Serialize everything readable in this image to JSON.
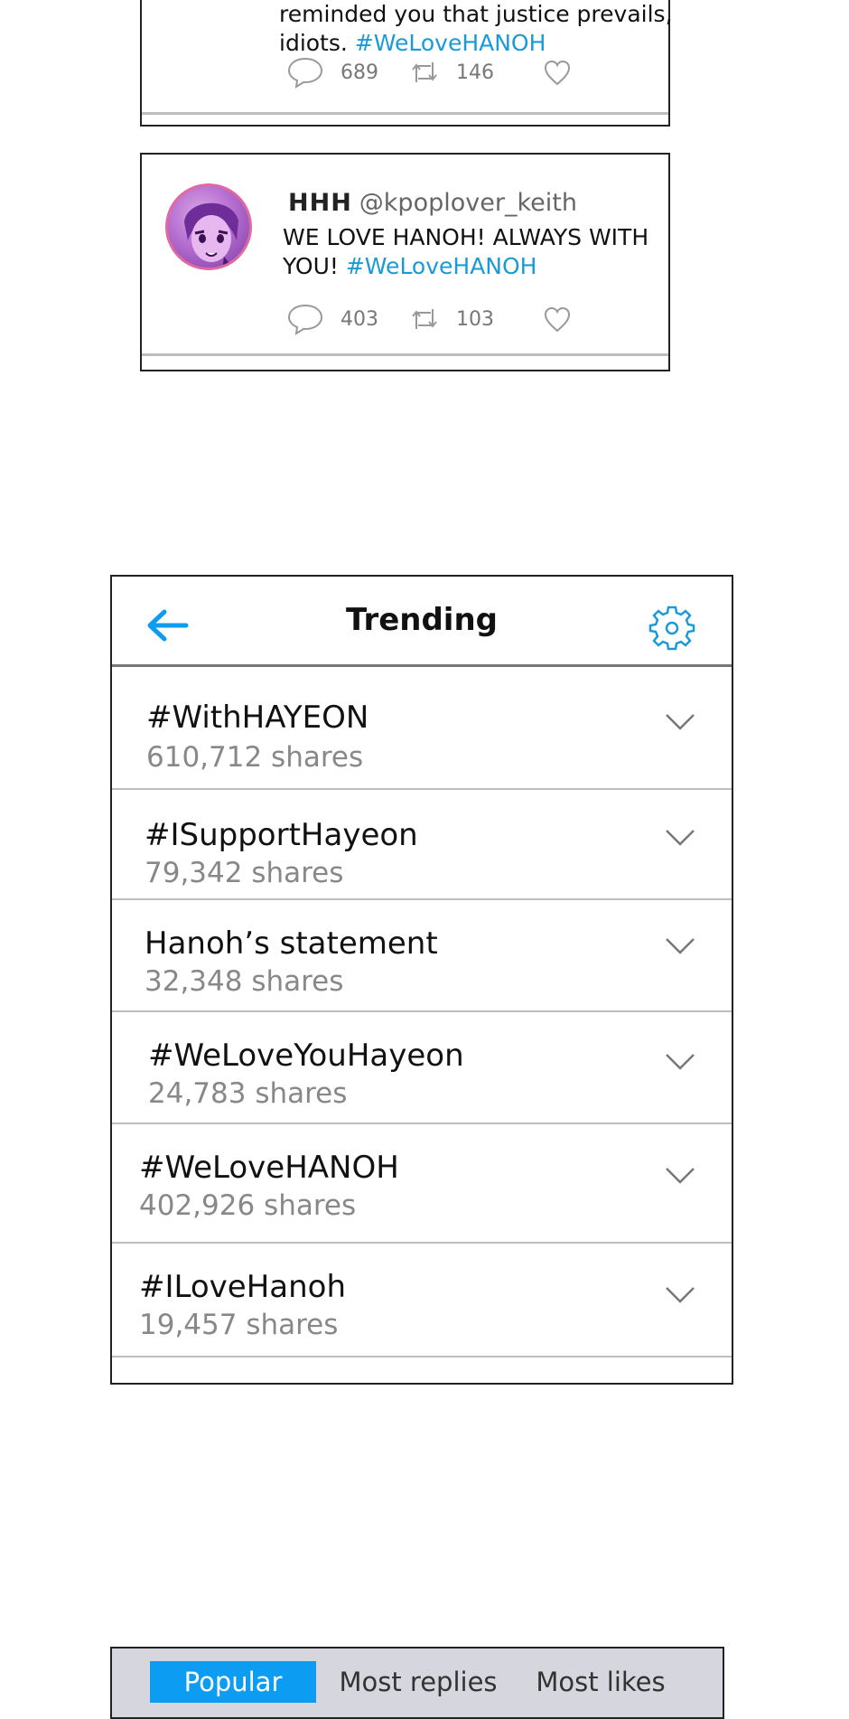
{
  "tweets": [
    {
      "text_line1": "reminded you that justice prevails,",
      "text_line2_prefix": "idiots. ",
      "hashtag": "#WeLoveHANOH",
      "replies": "689",
      "retweets": "146"
    },
    {
      "name": "HHH",
      "handle": "@kpoplover_keith",
      "text_line1": "WE LOVE HANOH! ALWAYS WITH",
      "text_line2_prefix": "YOU! ",
      "hashtag": "#WeLoveHANOH",
      "replies": "403",
      "retweets": "103"
    }
  ],
  "trending": {
    "title": "Trending",
    "items": [
      {
        "name": "#WithHAYEON",
        "shares": "610,712 shares"
      },
      {
        "name": "#ISupportHayeon",
        "shares": "79,342 shares"
      },
      {
        "name": "Hanoh’s statement",
        "shares": "32,348 shares"
      },
      {
        "name": "#WeLoveYouHayeon",
        "shares": "24,783 shares"
      },
      {
        "name": "#WeLoveHANOH",
        "shares": "402,926 shares"
      },
      {
        "name": "#ILoveHanoh",
        "shares": "19,457 shares"
      }
    ]
  },
  "tabs": [
    {
      "label": "Popular",
      "active": true
    },
    {
      "label": "Most replies",
      "active": false
    },
    {
      "label": "Most likes",
      "active": false
    }
  ],
  "colors": {
    "accent": "#0c9cf2",
    "hashtag": "#1a9ad6",
    "tab_bar": "#d6d6de"
  }
}
